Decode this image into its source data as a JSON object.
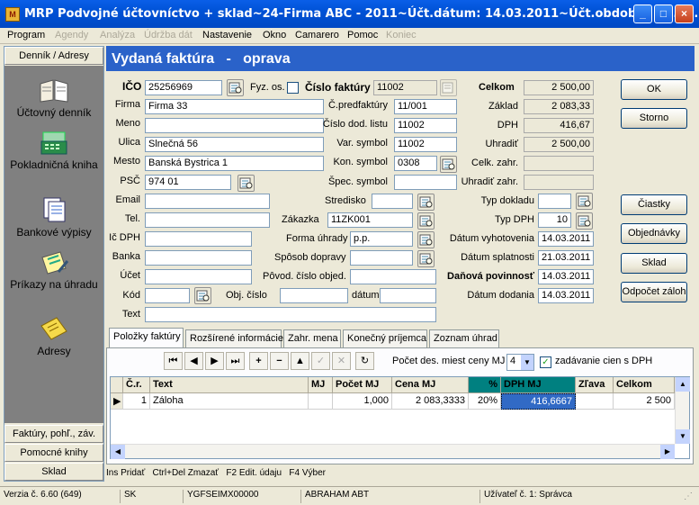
{
  "window": {
    "title": "MRP Podvojné účtovníctvo + sklad~24-Firma ABC - 2011~Účt.dátum: 14.03.2011~Účt.obdobie: 01.01.20...",
    "app_icon_text": "M"
  },
  "menu": [
    {
      "label": "Program",
      "enabled": true
    },
    {
      "label": "Agendy",
      "enabled": false
    },
    {
      "label": "Analýza",
      "enabled": false
    },
    {
      "label": "Údržba dát",
      "enabled": false
    },
    {
      "label": "Nastavenie",
      "enabled": true
    },
    {
      "label": "Okno",
      "enabled": true
    },
    {
      "label": "Camarero",
      "enabled": true
    },
    {
      "label": "Pomoc",
      "enabled": true
    },
    {
      "label": "Koniec",
      "enabled": false
    }
  ],
  "left_pane": {
    "top_tab": "Denník / Adresy",
    "items": [
      {
        "label": "Účtovný denník",
        "icon": "book-icon"
      },
      {
        "label": "Pokladničná kniha",
        "icon": "cash-register-icon"
      },
      {
        "label": "Bankové výpisy",
        "icon": "bank-statement-icon"
      },
      {
        "label": "Príkazy na úhradu",
        "icon": "payment-order-icon"
      },
      {
        "label": "Adresy",
        "icon": "address-envelope-icon"
      }
    ],
    "bottom_tabs": [
      "Faktúry, pohľ., záv.",
      "Pomocné knihy",
      "Sklad"
    ]
  },
  "header": {
    "title": "Vydaná faktúra   -   oprava"
  },
  "partner": {
    "ico_label": "IČO",
    "ico": "25256969",
    "fyz_label": "Fyz. os.",
    "firma_label": "Firma",
    "firma": "Firma 33",
    "meno_label": "Meno",
    "meno": "",
    "ulica_label": "Ulica",
    "ulica": "Slnečná 56",
    "mesto_label": "Mesto",
    "mesto": "Banská Bystrica 1",
    "psc_label": "PSČ",
    "psc": "974 01",
    "email_label": "Email",
    "email": "",
    "tel_label": "Tel.",
    "tel": "",
    "icdph_label": "Ič DPH",
    "icdph": "",
    "banka_label": "Banka",
    "banka": "",
    "ucet_label": "Účet",
    "ucet": "",
    "kod_label": "Kód",
    "kod": "",
    "text_label": "Text",
    "text": ""
  },
  "invoice": {
    "cislo_label": "Číslo faktúry",
    "cislo": "11002",
    "cpred_label": "Č.predfaktúry",
    "cpred": "11/001",
    "cdod_label": "Číslo dod. listu",
    "cdod": "11002",
    "var_label": "Var. symbol",
    "var": "11002",
    "kon_label": "Kon. symbol",
    "kon": "0308",
    "spec_label": "Špec. symbol",
    "spec": "",
    "stredisko_label": "Stredisko",
    "stredisko": "",
    "zakazka_label": "Zákazka",
    "zakazka": "11ZK001",
    "forma_label": "Forma úhrady",
    "forma": "p.p.",
    "sposob_label": "Spôsob dopravy",
    "sposob": "",
    "povod_label": "Pôvod. číslo objed.",
    "povod": "",
    "obj_label": "Obj. číslo",
    "obj": "",
    "datum_label": "dátum",
    "datum": ""
  },
  "totals": {
    "celkom_label": "Celkom",
    "celkom": "2 500,00",
    "zaklad_label": "Základ",
    "zaklad": "2 083,33",
    "dph_label": "DPH",
    "dph": "416,67",
    "uhradit_label": "Uhradiť",
    "uhradit": "2 500,00",
    "celk_zahr_label": "Celk. zahr.",
    "celk_zahr": "",
    "uhradit_zahr_label": "Uhradiť zahr.",
    "uhradit_zahr": "",
    "typ_dokladu_label": "Typ dokladu",
    "typ_dokladu": "",
    "typ_dph_label": "Typ DPH",
    "typ_dph": "10",
    "vyhotovenia_label": "Dátum vyhotovenia",
    "vyhotovenia": "14.03.2011",
    "splatnosti_label": "Dátum splatnosti",
    "splatnosti": "21.03.2011",
    "danova_label": "Daňová povinnosť",
    "danova": "14.03.2011",
    "dodania_label": "Dátum dodania",
    "dodania": "14.03.2011"
  },
  "buttons": {
    "ok": "OK",
    "storno": "Storno",
    "ciastky": "Čiastky",
    "objednavky": "Objednávky",
    "sklad": "Sklad",
    "odpocet": "Odpočet záloh"
  },
  "tabs": [
    "Položky faktúry",
    "Rozšírené informácie",
    "Zahr. mena",
    "Konečný príjemca",
    "Zoznam úhrad"
  ],
  "grid_tools": {
    "pocet_label": "Počet des. miest ceny MJ",
    "pocet_value": "4",
    "zadavanie_label": "zadávanie cien s DPH"
  },
  "grid": {
    "columns": [
      "Č.r.",
      "Text",
      "MJ",
      "Počet MJ",
      "Cena MJ",
      "%",
      "DPH MJ",
      "Zľava",
      "Celkom"
    ],
    "rows": [
      {
        "cr": "1",
        "text": "Záloha",
        "mj": "",
        "pocet": "1,000",
        "cena": "2 083,3333",
        "pct": "20%",
        "dphmj": "416,6667",
        "zlava": "",
        "celkom": "2 500"
      }
    ]
  },
  "hint": "Ins Pridať   Ctrl+Del Zmazať   F2 Edit. údaju   F4 Výber",
  "status": {
    "version": "Verzia č. 6.60 (649)",
    "lang": "SK",
    "code": "YGFSEIMX00000",
    "company": "ABRAHAM ABT",
    "user": "Užívateľ č. 1: Správca"
  },
  "colors": {
    "header_blue": "#2a62c9",
    "selection": "#316ac5",
    "teal": "#008080"
  }
}
